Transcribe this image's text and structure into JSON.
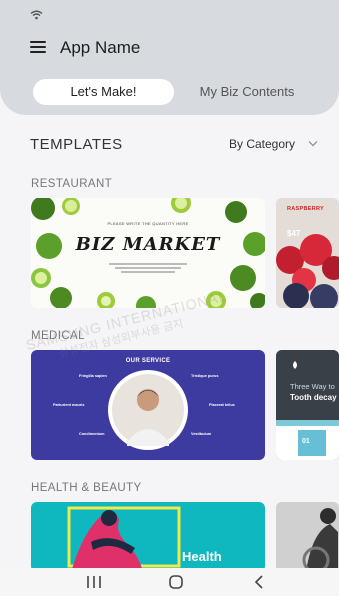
{
  "header": {
    "app_name": "App Name",
    "tabs": [
      {
        "label": "Let's Make!",
        "active": true
      },
      {
        "label": "My Biz Contents",
        "active": false
      }
    ]
  },
  "templates": {
    "heading": "TEMPLATES",
    "filter_label": "By Category",
    "categories": [
      {
        "name": "RESTAURANT",
        "main_card": {
          "small_text": "PLEASE WRITE THE QUANTITY HERE",
          "title": "BIZ MARKET"
        },
        "side_card": {
          "label": "RASPBERRY",
          "price": "$47"
        }
      },
      {
        "name": "MEDICAL",
        "main_card": {
          "title": "OUR SERVICE",
          "labels": [
            "Fringilla sapien",
            "Tristique purus",
            "Parturient mauris",
            "Placerat tellus",
            "Condimentum",
            "Vestibulum"
          ]
        },
        "side_card": {
          "line1": "Three Way to",
          "line2": "Tooth decay",
          "number": "01"
        }
      },
      {
        "name": "HEALTH & BEAUTY",
        "main_card": {
          "title": "Health"
        }
      }
    ]
  },
  "watermark": {
    "line1": "SAMSUNG INTERNATIONAL",
    "line2": "삼성전자 삼성외부사용 금지"
  },
  "colors": {
    "header_bg": "#d7dbe0",
    "page_bg": "#f5f5f7",
    "medical_bg": "#3d3aa0",
    "health_bg": "#0fb8be"
  },
  "navbar": {
    "icons": [
      "recent-apps-icon",
      "home-icon",
      "back-icon"
    ]
  }
}
